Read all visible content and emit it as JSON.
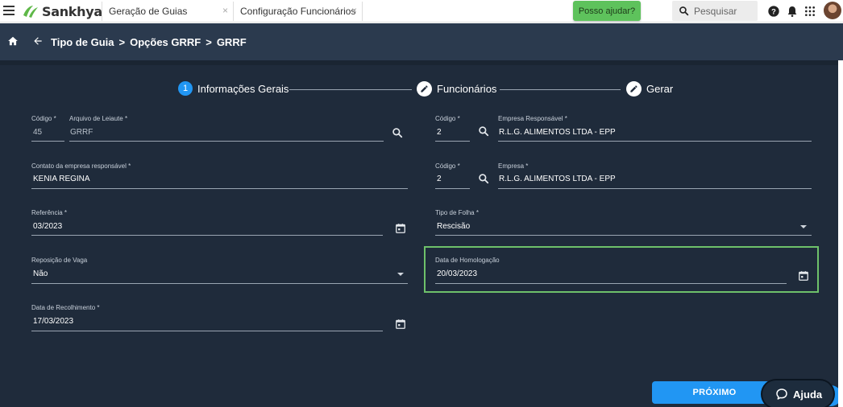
{
  "topbar": {
    "brand": "Sankhya",
    "tabs": [
      {
        "label": "Geração de Guias",
        "close": "×"
      },
      {
        "label": "Configuração Funcionários",
        "close": "×"
      }
    ],
    "help_chip": "Posso ajudar?",
    "search_placeholder": "Pesquisar",
    "icons": [
      "menu-icon",
      "help-icon",
      "bell-icon",
      "apps-grid-icon"
    ]
  },
  "breadcrumb": {
    "items": [
      "Tipo de Guia",
      "Opções GRRF",
      "GRRF"
    ],
    "separator": ">"
  },
  "stepper": {
    "steps": [
      {
        "number": "1",
        "label": "Informações Gerais",
        "state": "active"
      },
      {
        "label": "Funcionários",
        "state": "edit"
      },
      {
        "label": "Gerar",
        "state": "edit"
      }
    ]
  },
  "form": {
    "codigo_label": "Código *",
    "codigo_value": "45",
    "arquivo_label": "Arquivo de Leiaute *",
    "arquivo_value": "GRRF",
    "contato_label": "Contato da empresa responsável *",
    "contato_value": "KENIA REGINA",
    "referencia_label": "Referência *",
    "referencia_value": "03/2023",
    "reposicao_label": "Reposição de Vaga",
    "reposicao_value": "Não",
    "recolhimento_label": "Data de Recolhimento *",
    "recolhimento_value": "17/03/2023",
    "codigo2_label": "Código *",
    "codigo2_value": "2",
    "empresa_resp_label": "Empresa Responsável *",
    "empresa_resp_value": "R.L.G. ALIMENTOS LTDA - EPP",
    "codigo3_label": "Código *",
    "codigo3_value": "2",
    "empresa_label": "Empresa *",
    "empresa_value": "R.L.G. ALIMENTOS LTDA - EPP",
    "tipo_folha_label": "Tipo de Folha *",
    "tipo_folha_value": "Rescisão",
    "homologacao_label": "Data de Homologação",
    "homologacao_value": "20/03/2023"
  },
  "actions": {
    "next_label": "PRÓXIMO",
    "ajuda_label": "Ajuda"
  },
  "colors": {
    "panel_bg": "#1f2b3b",
    "header_bg": "#2b3a4e",
    "accent_blue": "#2196f3",
    "highlight_green": "#6ec16a",
    "help_green": "#5ec25c"
  }
}
